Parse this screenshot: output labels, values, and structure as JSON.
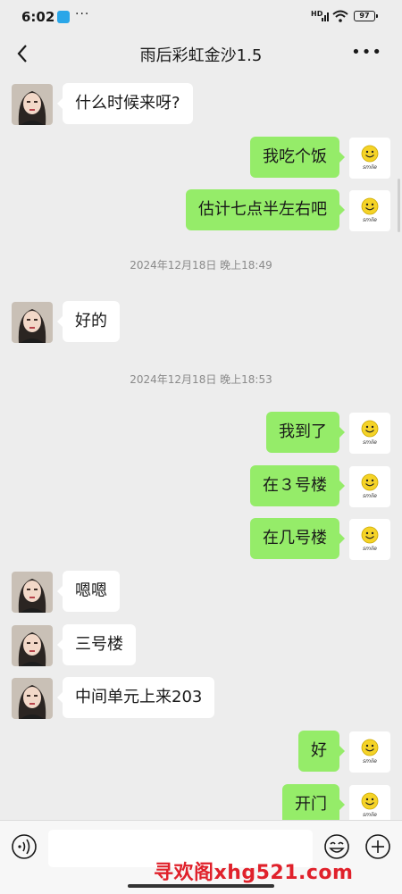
{
  "status_bar": {
    "time": "6:02",
    "dots": "···",
    "network": "HD",
    "battery": "97"
  },
  "header": {
    "title": "雨后彩虹金沙1.5"
  },
  "smile_label": "smile",
  "messages": [
    {
      "side": "left",
      "type": "text",
      "text": "什么时候来呀?"
    },
    {
      "side": "right",
      "type": "text",
      "text": "我吃个饭"
    },
    {
      "side": "right",
      "type": "text",
      "text": "估计七点半左右吧"
    },
    {
      "type": "time",
      "text": "2024年12月18日 晚上18:49"
    },
    {
      "side": "left",
      "type": "text",
      "text": "好的"
    },
    {
      "type": "time",
      "text": "2024年12月18日 晚上18:53"
    },
    {
      "side": "right",
      "type": "text",
      "text": "我到了"
    },
    {
      "side": "right",
      "type": "text",
      "text": "在３号楼"
    },
    {
      "side": "right",
      "type": "text",
      "text": "在几号楼"
    },
    {
      "side": "left",
      "type": "text",
      "text": "嗯嗯"
    },
    {
      "side": "left",
      "type": "text",
      "text": "三号楼"
    },
    {
      "side": "left",
      "type": "text",
      "text": "中间单元上来203"
    },
    {
      "side": "right",
      "type": "text",
      "text": "好"
    },
    {
      "side": "right",
      "type": "text",
      "text": "开门"
    }
  ],
  "input": {
    "placeholder": ""
  },
  "watermark": "寻欢阁xhg521.com",
  "colors": {
    "background": "#ededed",
    "sent_bubble": "#95ec69",
    "received_bubble": "#ffffff",
    "watermark": "#e0212b"
  }
}
